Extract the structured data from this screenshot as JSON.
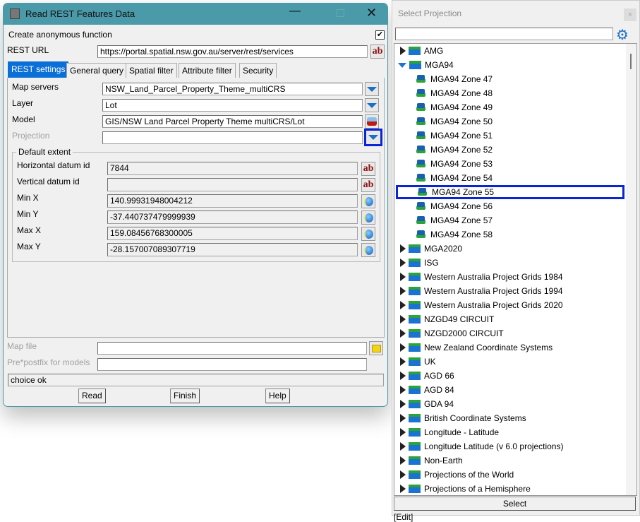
{
  "dialog": {
    "title": "Read REST Features Data",
    "anon_label": "Create anonymous function",
    "anon_checked": true,
    "rest_url_label": "REST URL",
    "rest_url": "https://portal.spatial.nsw.gov.au/server/rest/services",
    "tabs": [
      "REST settings",
      "General query",
      "Spatial filter",
      "Attribute filter",
      "Security"
    ],
    "map_servers_label": "Map servers",
    "map_servers": "NSW_Land_Parcel_Property_Theme_multiCRS",
    "layer_label": "Layer",
    "layer": "Lot",
    "model_label": "Model",
    "model": "GIS/NSW Land Parcel Property Theme multiCRS/Lot",
    "projection_label": "Projection",
    "projection": "",
    "extent_title": "Default extent",
    "hdatum_label": "Horizontal datum id",
    "hdatum": "7844",
    "vdatum_label": "Vertical datum id",
    "vdatum": "",
    "minx_label": "Min X",
    "minx": "140.99931948004212",
    "miny_label": "Min Y",
    "miny": "-37.440737479999939",
    "maxx_label": "Max X",
    "maxx": "159.08456768300005",
    "maxy_label": "Max Y",
    "maxy": "-28.157007089307719",
    "mapfile_label": "Map file",
    "mapfile": "",
    "prefix_label": "Pre*postfix for models",
    "prefix": "",
    "status": "choice ok",
    "read": "Read",
    "finish": "Finish",
    "help": "Help",
    "ab": "ab"
  },
  "picker": {
    "title": "Select Projection",
    "close": "×",
    "search": "",
    "select": "Select",
    "footer": "[Edit]",
    "tree": [
      {
        "label": "AMG",
        "type": "folder"
      },
      {
        "label": "MGA94",
        "type": "folder",
        "open": true
      },
      {
        "label": "MGA94 Zone 47",
        "type": "leaf"
      },
      {
        "label": "MGA94 Zone 48",
        "type": "leaf"
      },
      {
        "label": "MGA94 Zone 49",
        "type": "leaf"
      },
      {
        "label": "MGA94 Zone 50",
        "type": "leaf"
      },
      {
        "label": "MGA94 Zone 51",
        "type": "leaf"
      },
      {
        "label": "MGA94 Zone 52",
        "type": "leaf"
      },
      {
        "label": "MGA94 Zone 53",
        "type": "leaf"
      },
      {
        "label": "MGA94 Zone 54",
        "type": "leaf"
      },
      {
        "label": "MGA94 Zone 55",
        "type": "leaf",
        "selected": true
      },
      {
        "label": "MGA94 Zone 56",
        "type": "leaf"
      },
      {
        "label": "MGA94 Zone 57",
        "type": "leaf"
      },
      {
        "label": "MGA94 Zone 58",
        "type": "leaf"
      },
      {
        "label": "MGA2020",
        "type": "folder"
      },
      {
        "label": "ISG",
        "type": "folder"
      },
      {
        "label": "Western Australia Project Grids 1984",
        "type": "folder"
      },
      {
        "label": "Western Australia Project Grids 1994",
        "type": "folder"
      },
      {
        "label": "Western Australia Project Grids 2020",
        "type": "folder"
      },
      {
        "label": "NZGD49 CIRCUIT",
        "type": "folder"
      },
      {
        "label": "NZGD2000 CIRCUIT",
        "type": "folder"
      },
      {
        "label": "New Zealand Coordinate Systems",
        "type": "folder"
      },
      {
        "label": "UK",
        "type": "folder"
      },
      {
        "label": "AGD 66",
        "type": "folder"
      },
      {
        "label": "AGD 84",
        "type": "folder"
      },
      {
        "label": "GDA 94",
        "type": "folder"
      },
      {
        "label": "British Coordinate Systems",
        "type": "folder"
      },
      {
        "label": "Longitude - Latitude",
        "type": "folder"
      },
      {
        "label": "Longitude Latitude (v 6.0 projections)",
        "type": "folder"
      },
      {
        "label": "Non-Earth",
        "type": "folder"
      },
      {
        "label": "Projections of the World",
        "type": "folder"
      },
      {
        "label": "Projections of a Hemisphere",
        "type": "folder"
      }
    ]
  },
  "colors": {
    "titlebar": "#4a9aaa",
    "highlight": "#0a24d8",
    "tab_active": "#0a6fd6"
  }
}
